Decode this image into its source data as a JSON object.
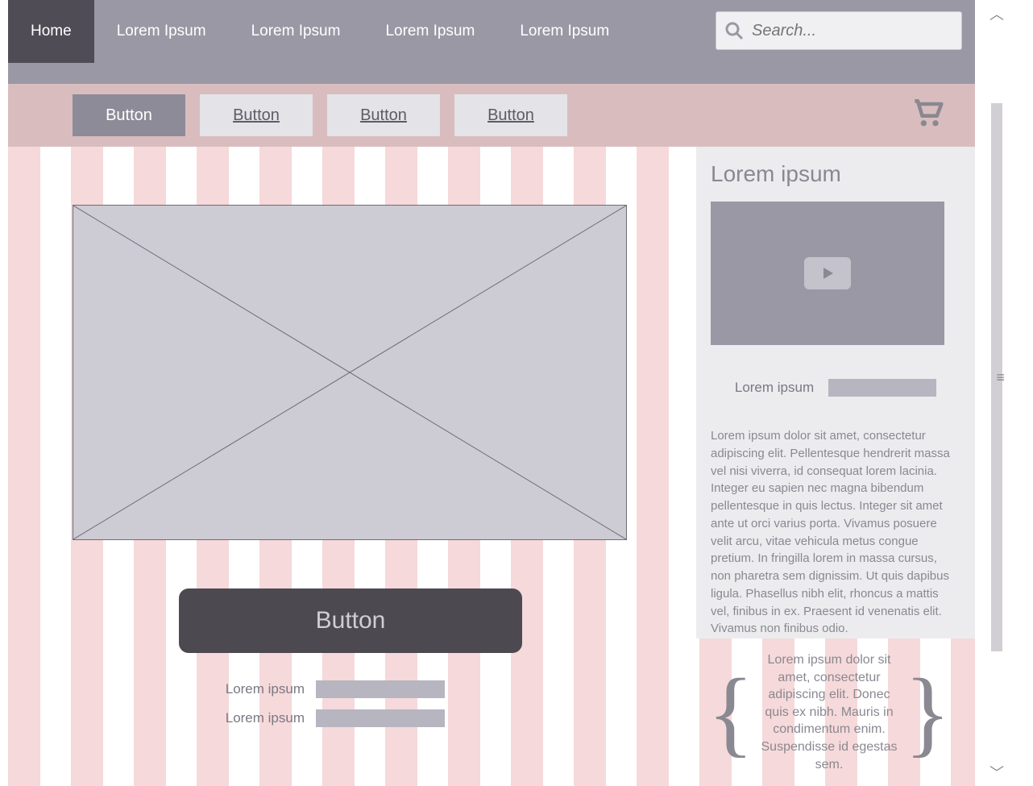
{
  "nav": {
    "items": [
      "Home",
      "Lorem Ipsum",
      "Lorem Ipsum",
      "Lorem Ipsum",
      "Lorem Ipsum"
    ],
    "active": 0
  },
  "search": {
    "placeholder": "Search..."
  },
  "subbar": {
    "buttons": [
      "Button",
      "Button",
      "Button",
      "Button"
    ],
    "active": 0
  },
  "main": {
    "big_button": "Button",
    "fields": [
      {
        "label": "Lorem ipsum"
      },
      {
        "label": "Lorem ipsum"
      }
    ]
  },
  "sidebar": {
    "title": "Lorem ipsum",
    "field_label": "Lorem ipsum",
    "paragraph": "Lorem ipsum dolor sit amet, consectetur adipiscing elit. Pellentesque hendrerit massa vel nisi viverra, id consequat lorem lacinia. Integer eu sapien nec magna bibendum pellentesque in quis lectus. Integer sit amet ante ut orci varius porta. Vivamus posuere velit arcu, vitae vehicula metus congue pretium. In fringilla lorem in massa cursus, non pharetra sem dignissim. Ut quis dapibus ligula. Phasellus nibh elit, rhoncus a mattis vel, finibus in ex. Praesent id venenatis elit. Vivamus non finibus odio."
  },
  "quote": {
    "text": "Lorem ipsum dolor sit amet, consectetur adipiscing elit. Donec quis ex nibh. Mauris in condimentum enim. Suspendisse id egestas sem."
  }
}
